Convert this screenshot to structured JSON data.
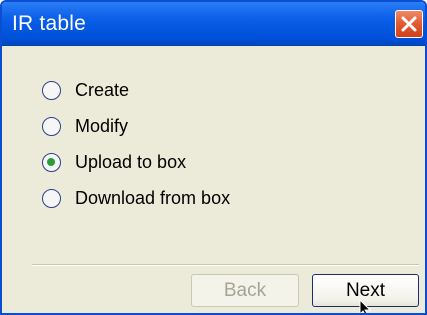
{
  "window": {
    "title": "IR table",
    "close_icon": "close-icon"
  },
  "options": [
    {
      "label": "Create",
      "selected": false
    },
    {
      "label": "Modify",
      "selected": false
    },
    {
      "label": "Upload to box",
      "selected": true
    },
    {
      "label": "Download from box",
      "selected": false
    }
  ],
  "buttons": {
    "back_label": "Back",
    "back_enabled": false,
    "next_label": "Next",
    "next_enabled": true
  },
  "colors": {
    "titlebar": "#0a5ee8",
    "close_button": "#e25a31",
    "dialog_bg": "#ecead8",
    "radio_selected": "#2a9d3a"
  },
  "cursor_icon": "mouse-pointer-icon"
}
